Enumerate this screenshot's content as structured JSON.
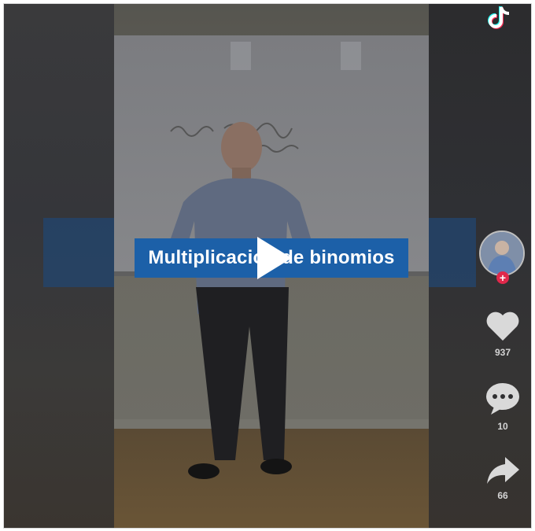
{
  "video": {
    "caption": "Multiplicación de binomios"
  },
  "actions": {
    "likes": "937",
    "comments": "10",
    "shares": "66"
  },
  "icons": {
    "logo": "tiktok-logo-icon",
    "play": "play-icon",
    "like": "heart-icon",
    "comment": "comment-icon",
    "share": "share-icon",
    "follow": "plus-icon"
  },
  "colors": {
    "caption_bg": "#1c60a8",
    "follow_badge": "#e0284b"
  }
}
